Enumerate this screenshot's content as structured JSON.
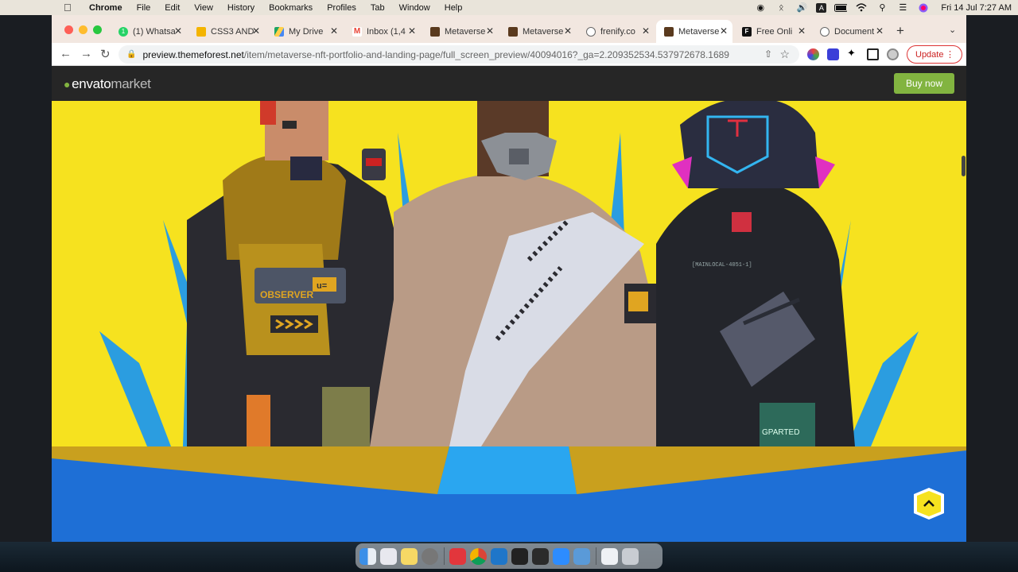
{
  "menubar": {
    "app_name": "Chrome",
    "menus": [
      "File",
      "Edit",
      "View",
      "History",
      "Bookmarks",
      "Profiles",
      "Tab",
      "Window",
      "Help"
    ],
    "clock": "Fri 14 Jul  7:27 AM"
  },
  "tabs": [
    {
      "title": "(1) Whatsapp",
      "icon": "whatsapp-icon",
      "color": "#25d366"
    },
    {
      "title": "CSS3 AND",
      "icon": "slides-icon",
      "color": "#f4b400"
    },
    {
      "title": "My Drive",
      "icon": "drive-icon",
      "color": "#1fa463"
    },
    {
      "title": "Inbox (1,4",
      "icon": "gmail-icon",
      "color": "#ea4335"
    },
    {
      "title": "Metaverse",
      "icon": "metaverse-favicon",
      "color": "#5a3a1e"
    },
    {
      "title": "Metaverse",
      "icon": "metaverse-favicon",
      "color": "#5a3a1e"
    },
    {
      "title": "frenify.co",
      "icon": "globe-icon",
      "color": "#777777"
    },
    {
      "title": "Metaverse",
      "icon": "metaverse-favicon",
      "color": "#5a3a1e",
      "active": true
    },
    {
      "title": "Free Onli",
      "icon": "ff-icon",
      "color": "#111111"
    },
    {
      "title": "Document",
      "icon": "globe-icon",
      "color": "#777777"
    }
  ],
  "address_bar": {
    "host": "preview.themeforest.net",
    "path": "/item/metaverse-nft-portfolio-and-landing-page/full_screen_preview/40094016?_ga=2.209352534.537972678.16892..."
  },
  "update_label": "Update",
  "envato": {
    "logo_bold": "envato",
    "logo_light": "market",
    "buy_label": "Buy now",
    "brand_color": "#82b440"
  },
  "hero": {
    "background": "#f6e21f",
    "characters": [
      {
        "chest_label": "OBSERVER",
        "badge": "u="
      },
      {
        "name": "masked-robed"
      },
      {
        "chest_text": "[MAINLOCAL-4051-1]",
        "bag_text": "GPARTED"
      }
    ]
  },
  "dock": {
    "apps": [
      "finder",
      "launchpad",
      "notes",
      "system-preferences",
      "anydesk",
      "chrome",
      "vscode",
      "terminal",
      "piano",
      "zoom",
      "tableplus",
      "downloads",
      "trash"
    ]
  }
}
